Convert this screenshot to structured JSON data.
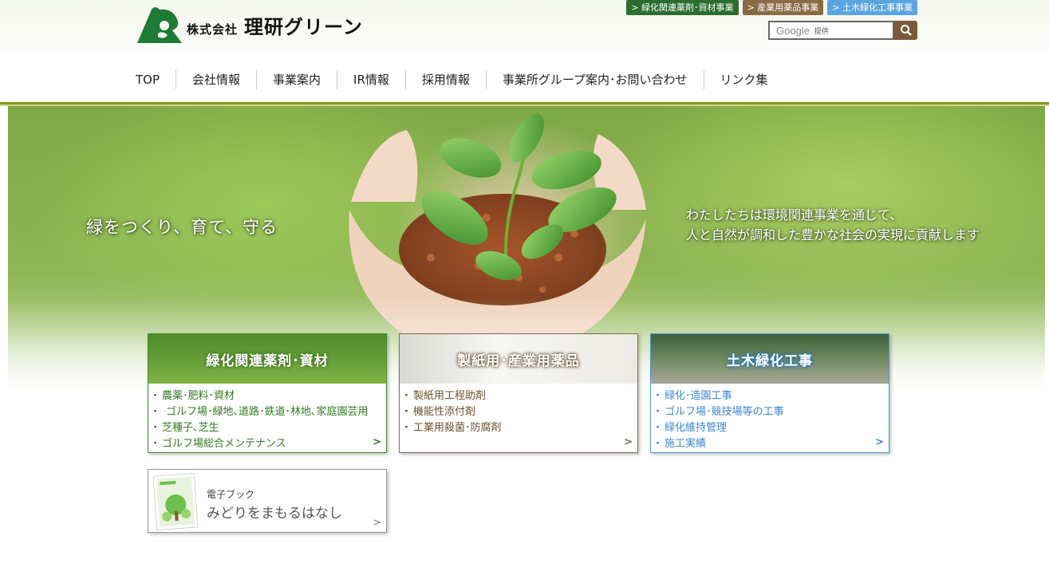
{
  "header": {
    "logo": {
      "corp": "株式会社",
      "name": "理研グリーン"
    },
    "quick_links": [
      {
        "label": "> 緑化関連薬剤･資材事業",
        "color": "#2a6d2f"
      },
      {
        "label": "> 産業用薬品事業",
        "color": "#8a6a45"
      },
      {
        "label": "> 土木緑化工事事業",
        "color": "#5aa5e0"
      }
    ],
    "search": {
      "brand": "Google",
      "provided": "提供"
    }
  },
  "nav": {
    "items": [
      "TOP",
      "会社情報",
      "事業案内",
      "IR情報",
      "採用情報",
      "事業所グループ案内･お問い合わせ",
      "リンク集"
    ]
  },
  "hero": {
    "slogan": "緑をつくり、育て、守る",
    "mission_line1": "わたしたちは環境関連事業を通じて、",
    "mission_line2": "人と自然が調和した豊かな社会の実現に貢献します"
  },
  "cards": [
    {
      "title": "緑化関連薬剤･資材",
      "items": [
        "農薬･肥料･資材",
        "ゴルフ場･緑地､道路･鉄道･林地､家庭園芸用",
        "芝種子､芝生",
        "ゴルフ場総合メンテナンス"
      ],
      "accent": "#3d8a2a"
    },
    {
      "title": "製紙用･産業用薬品",
      "items": [
        "製紙用工程助剤",
        "機能性添付剤",
        "工業用殺菌･防腐剤"
      ],
      "accent": "#8b6c40"
    },
    {
      "title": "土木緑化工事",
      "items": [
        "緑化･造園工事",
        "ゴルフ場･競技場等の工事",
        "緑化維持管理",
        "施工実績"
      ],
      "accent": "#4e97d6"
    }
  ],
  "ebook": {
    "label": "電子ブック",
    "title": "みどりをまもるはなし"
  },
  "colors": {
    "nav_underline": "#7e9b12",
    "brand_green": "#1f7a35"
  }
}
